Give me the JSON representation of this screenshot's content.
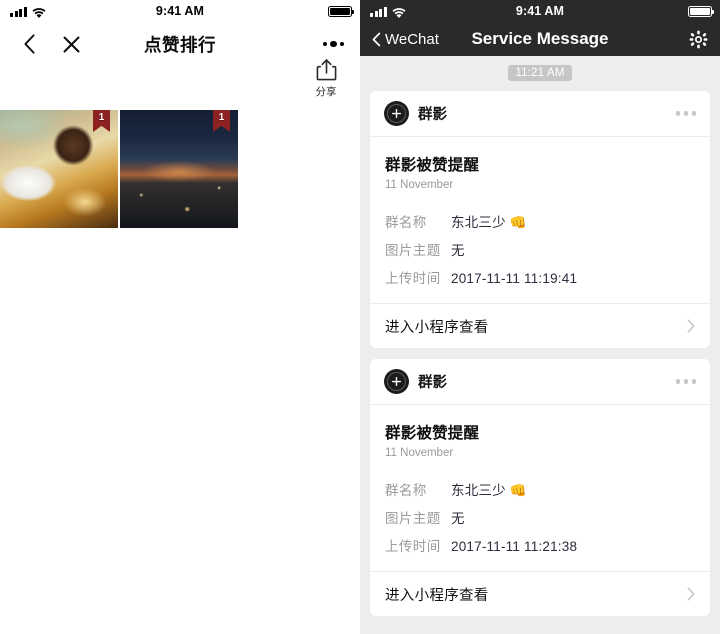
{
  "left_panel": {
    "status_bar": {
      "time": "9:41 AM",
      "signal_icon": "signal-bars-icon",
      "wifi_icon": "wifi-icon",
      "battery_icon": "battery-icon"
    },
    "navbar": {
      "back_icon": "chevron-left-icon",
      "close_icon": "close-icon",
      "title": "点赞排行",
      "more_icon": "more-dots-icon"
    },
    "share": {
      "icon": "share-icon",
      "label": "分享"
    },
    "photos": [
      {
        "name": "photo-fast-food",
        "badge": "1",
        "alt": "fast food meal on table"
      },
      {
        "name": "photo-night-city",
        "badge": "1",
        "alt": "night cityscape at dusk"
      }
    ]
  },
  "right_panel": {
    "status_bar": {
      "time": "9:41 AM",
      "signal_icon": "signal-bars-icon",
      "wifi_icon": "wifi-icon",
      "battery_icon": "battery-icon"
    },
    "navbar": {
      "back_icon": "chevron-left-icon",
      "back_label": "WeChat",
      "title": "Service Message",
      "settings_icon": "gear-icon"
    },
    "timestamp": "11:21 AM",
    "cards": [
      {
        "avatar_icon": "camera-lens-plus-icon",
        "sender": "群影",
        "menu_icon": "more-dots-icon",
        "title": "群影被赞提醒",
        "date": "11 November",
        "fields": [
          {
            "key": "群名称",
            "value": "东北三少 👊"
          },
          {
            "key": "图片主题",
            "value": "无"
          },
          {
            "key": "上传时间",
            "value": "2017-11-11 11:19:41"
          }
        ],
        "footer_label": "进入小程序查看",
        "footer_icon": "chevron-right-icon"
      },
      {
        "avatar_icon": "camera-lens-plus-icon",
        "sender": "群影",
        "menu_icon": "more-dots-icon",
        "title": "群影被赞提醒",
        "date": "11 November",
        "fields": [
          {
            "key": "群名称",
            "value": "东北三少 👊"
          },
          {
            "key": "图片主题",
            "value": "无"
          },
          {
            "key": "上传时间",
            "value": "2017-11-11 11:21:38"
          }
        ],
        "footer_label": "进入小程序查看",
        "footer_icon": "chevron-right-icon"
      }
    ]
  },
  "colors": {
    "header_dark": "#2a2a2a",
    "chat_background": "#ededed",
    "card_background": "#ffffff",
    "key_gray": "#9b9b9b",
    "value_navy": "#2c2c3c",
    "badge_red": "#8c2222",
    "time_pill_gray": "#c6c6c6"
  }
}
